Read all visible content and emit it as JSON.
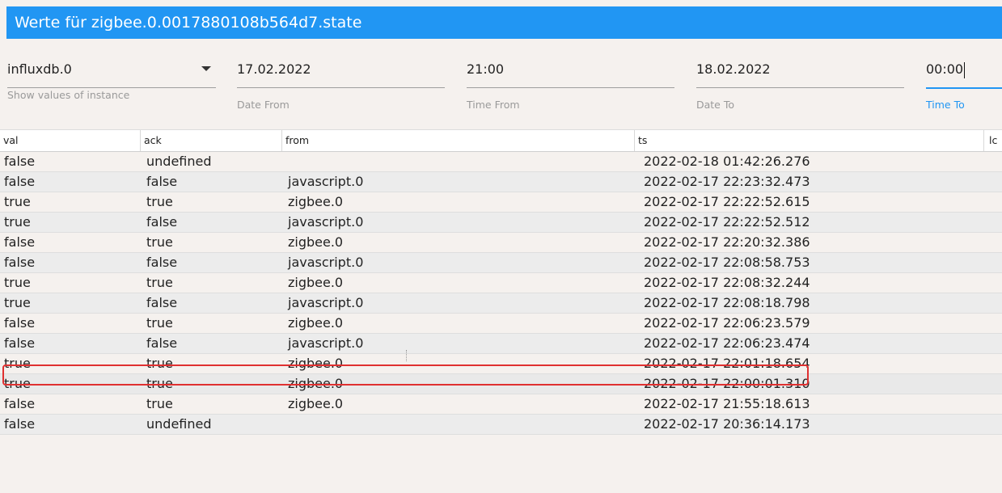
{
  "title": "Werte für zigbee.0.0017880108b564d7.state",
  "controls": {
    "instance": {
      "value": "influxdb.0",
      "label": "Show values of instance"
    },
    "date_from": {
      "value": "17.02.2022",
      "label": "Date From"
    },
    "time_from": {
      "value": "21:00",
      "label": "Time From"
    },
    "date_to": {
      "value": "18.02.2022",
      "label": "Date To"
    },
    "time_to": {
      "value": "00:00",
      "label": "Time To"
    }
  },
  "table": {
    "headers": {
      "val": "val",
      "ack": "ack",
      "from": "from",
      "ts": "ts",
      "lc": "lc"
    },
    "rows": [
      {
        "val": "false",
        "ack": "undefined",
        "from": "",
        "ts": "2022-02-18 01:42:26.276"
      },
      {
        "val": "false",
        "ack": "false",
        "from": "javascript.0",
        "ts": "2022-02-17 22:23:32.473"
      },
      {
        "val": "true",
        "ack": "true",
        "from": "zigbee.0",
        "ts": "2022-02-17 22:22:52.615"
      },
      {
        "val": "true",
        "ack": "false",
        "from": "javascript.0",
        "ts": "2022-02-17 22:22:52.512"
      },
      {
        "val": "false",
        "ack": "true",
        "from": "zigbee.0",
        "ts": "2022-02-17 22:20:32.386"
      },
      {
        "val": "false",
        "ack": "false",
        "from": "javascript.0",
        "ts": "2022-02-17 22:08:58.753"
      },
      {
        "val": "true",
        "ack": "true",
        "from": "zigbee.0",
        "ts": "2022-02-17 22:08:32.244"
      },
      {
        "val": "true",
        "ack": "false",
        "from": "javascript.0",
        "ts": "2022-02-17 22:08:18.798"
      },
      {
        "val": "false",
        "ack": "true",
        "from": "zigbee.0",
        "ts": "2022-02-17 22:06:23.579"
      },
      {
        "val": "false",
        "ack": "false",
        "from": "javascript.0",
        "ts": "2022-02-17 22:06:23.474"
      },
      {
        "val": "true",
        "ack": "true",
        "from": "zigbee.0",
        "ts": "2022-02-17 22:01:18.654"
      },
      {
        "val": "true",
        "ack": "true",
        "from": "zigbee.0",
        "ts": "2022-02-17 22:00:01.310"
      },
      {
        "val": "false",
        "ack": "true",
        "from": "zigbee.0",
        "ts": "2022-02-17 21:55:18.613"
      },
      {
        "val": "false",
        "ack": "undefined",
        "from": "",
        "ts": "2022-02-17 20:36:14.173"
      }
    ]
  },
  "colors": {
    "accent": "#2196f3",
    "highlight": "#e03030"
  }
}
